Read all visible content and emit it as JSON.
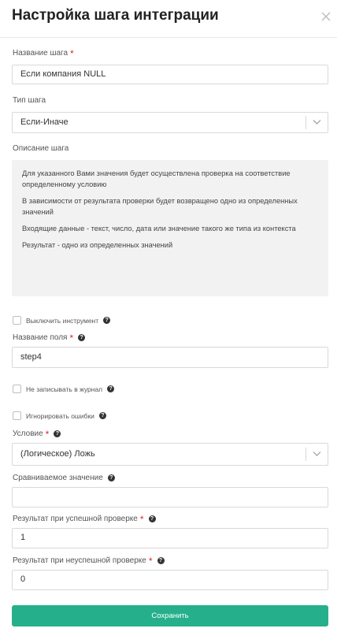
{
  "modal": {
    "title": "Настройка шага интеграции"
  },
  "fields": {
    "step_name": {
      "label": "Название шага",
      "value": "Если компания NULL"
    },
    "step_type": {
      "label": "Тип шага",
      "value": "Если-Иначе"
    },
    "description": {
      "label": "Описание шага",
      "paragraphs": [
        "Для указанного Вами значения будет осуществлена проверка на соответствие определенному условию",
        "В зависимости от результата проверки будет возвращено одно из определенных значений",
        "Входящие данные - текст, число, дата или значение такого же типа из контекста",
        "Результат - одно из определенных значений"
      ]
    },
    "disable_tool": {
      "label": "Выключить инструмент",
      "checked": false
    },
    "field_name": {
      "label": "Название поля",
      "value": "step4"
    },
    "no_log": {
      "label": "Не записывать в журнал",
      "checked": false
    },
    "ignore_errors": {
      "label": "Игнорировать ошибки",
      "checked": false
    },
    "condition": {
      "label": "Условие",
      "value": "(Логическое) Ложь"
    },
    "compare_value": {
      "label": "Сравниваемое значение",
      "value": ""
    },
    "success_result": {
      "label": "Результат при успешной проверке",
      "value": "1"
    },
    "fail_result": {
      "label": "Результат при неуспешной проверке",
      "value": "0"
    }
  },
  "buttons": {
    "save": "Сохранить"
  },
  "icons": {
    "help": "?",
    "close": "close-icon",
    "dropdown": "chevron-down-icon"
  },
  "colors": {
    "primary": "#25b08b",
    "required": "#e0282b",
    "description_bg": "#f2f2f2"
  }
}
